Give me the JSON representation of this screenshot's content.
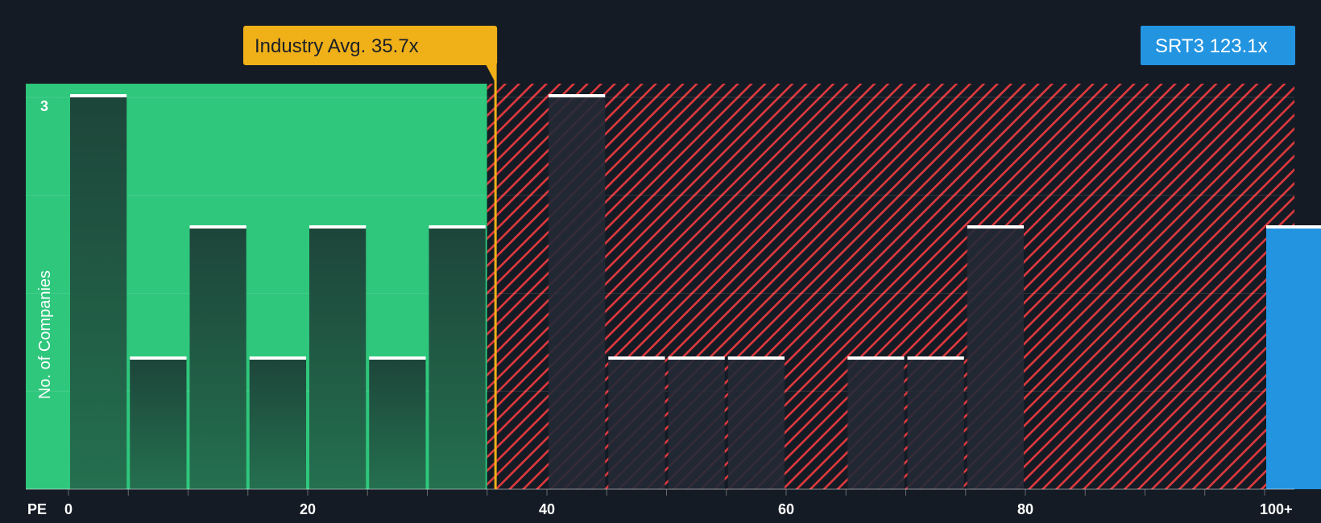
{
  "chart_data": {
    "type": "bar",
    "xlabel": "PE",
    "ylabel": "No. of Companies",
    "x_ticks": [
      {
        "value": 0,
        "label": "0"
      },
      {
        "value": 20,
        "label": "20"
      },
      {
        "value": 40,
        "label": "40"
      },
      {
        "value": 60,
        "label": "60"
      },
      {
        "value": 80,
        "label": "80"
      },
      {
        "value": 100,
        "label": "100+"
      }
    ],
    "y_tick_labels": [
      {
        "value": 3,
        "label": "3"
      }
    ],
    "bin_width": 5,
    "bins": [
      {
        "start": 0,
        "value": 3
      },
      {
        "start": 5,
        "value": 1
      },
      {
        "start": 10,
        "value": 2
      },
      {
        "start": 15,
        "value": 1
      },
      {
        "start": 20,
        "value": 2
      },
      {
        "start": 25,
        "value": 1
      },
      {
        "start": 30,
        "value": 2
      },
      {
        "start": 35,
        "value": 0
      },
      {
        "start": 40,
        "value": 3
      },
      {
        "start": 45,
        "value": 1
      },
      {
        "start": 50,
        "value": 1
      },
      {
        "start": 55,
        "value": 1
      },
      {
        "start": 60,
        "value": 0
      },
      {
        "start": 65,
        "value": 1
      },
      {
        "start": 70,
        "value": 1
      },
      {
        "start": 75,
        "value": 2
      },
      {
        "start": 80,
        "value": 0
      },
      {
        "start": 85,
        "value": 0
      },
      {
        "start": 90,
        "value": 0
      },
      {
        "start": 95,
        "value": 0
      },
      {
        "start": 100,
        "value": 2,
        "highlight": true
      }
    ],
    "ylim": [
      0,
      3
    ],
    "grid": true,
    "industry_average": {
      "value": 35.7,
      "label": "Industry Avg. 35.7x"
    },
    "company": {
      "ticker": "SRT3",
      "value": 123.1,
      "label": "SRT3 123.1x"
    },
    "colors": {
      "background": "#151b24",
      "undervalued_zone": "#2ec77c",
      "overvalued_hatch": "#e0393e",
      "bar_in_green": "#1d4a3c",
      "bar_in_red": "#222a36",
      "bar_cap": "#ffffff",
      "average_line": "#f0b018",
      "company_bar": "#2394e0"
    }
  }
}
